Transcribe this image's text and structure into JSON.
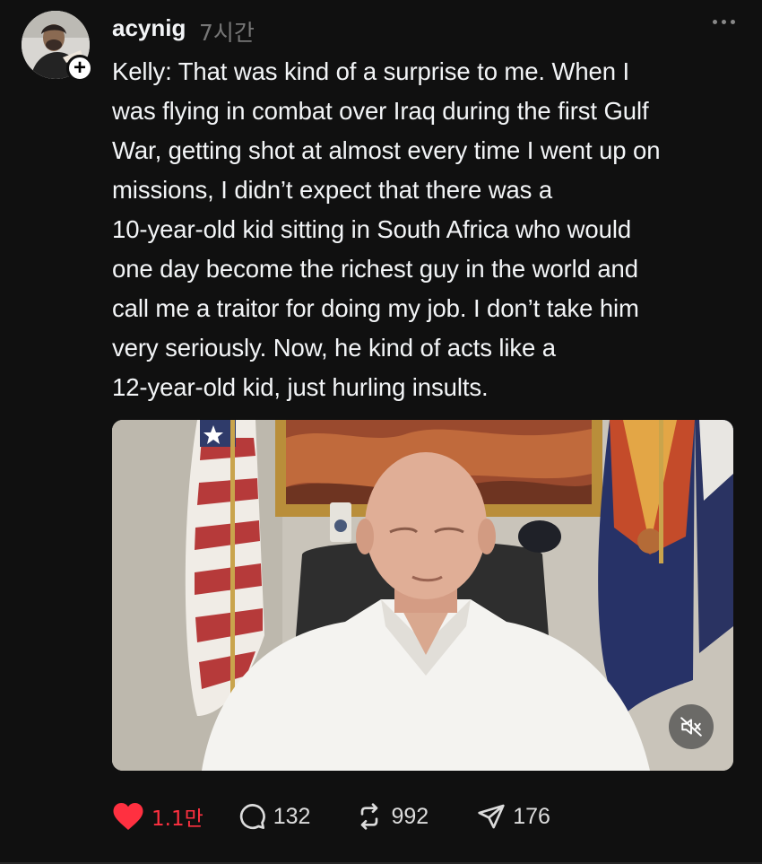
{
  "post": {
    "username": "acynig",
    "timestamp": "7시간",
    "text": "Kelly: That was kind of a surprise to me. When I\nwas flying in combat over Iraq during the first Gulf\nWar, getting shot at almost every time I went up on\nmissions, I didn’t expect that there was a\n10-year-old kid sitting in South Africa who would\none day become the richest guy in the world and\ncall me a traitor for doing my job. I don’t take him\nvery seriously. Now, he kind of acts like a\n12-year-old kid, just hurling insults."
  },
  "actions": {
    "likes": "1.1만",
    "replies": "132",
    "reposts": "992",
    "shares": "176"
  },
  "icons": {
    "follow": "plus-icon",
    "more": "more-horizontal-icon",
    "mute": "volume-muted-icon",
    "like": "heart-icon",
    "reply": "comment-icon",
    "repost": "repost-icon",
    "share": "send-icon"
  },
  "colors": {
    "background": "#101010",
    "like_active": "#ff3040",
    "text": "#f3f5f7",
    "muted_text": "#777777"
  }
}
